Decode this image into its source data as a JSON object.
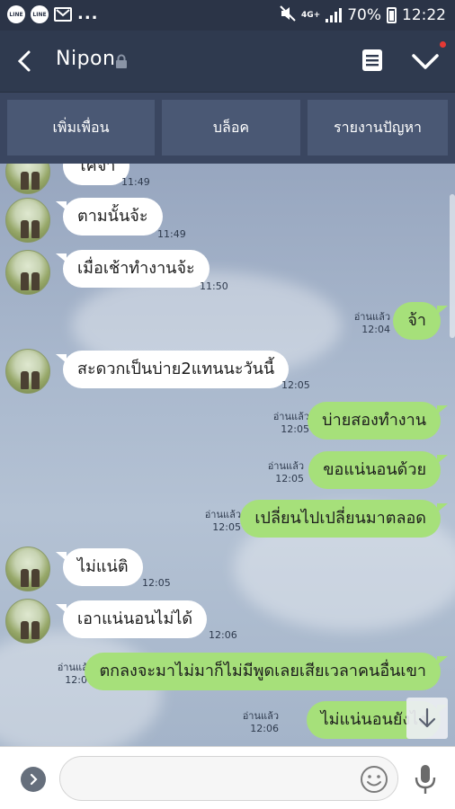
{
  "status_bar": {
    "left_icons": [
      "line-icon",
      "line-icon",
      "mail-icon"
    ],
    "left_badge_text": "LINE",
    "more": "...",
    "network": "4G+",
    "battery": "70%",
    "time": "12:22"
  },
  "header": {
    "contact_name": "Nipon",
    "icons": [
      "back-icon",
      "lock-icon",
      "note-icon",
      "chevron-down-icon"
    ]
  },
  "actions": [
    "เพิ่มเพื่อน",
    "บล็อค",
    "รายงานปัญหา"
  ],
  "messages": [
    {
      "side": "in",
      "text": "โคจ้า",
      "time": "11:49"
    },
    {
      "side": "in",
      "text": "ตามนั้นจ้ะ",
      "time": "11:49"
    },
    {
      "side": "in",
      "text": "เมื่อเช้าทำงานจ้ะ",
      "time": "11:50"
    },
    {
      "side": "out",
      "text": "จ้า",
      "read": "อ่านแล้ว",
      "time": "12:04"
    },
    {
      "side": "in",
      "text": "สะดวกเป็นบ่าย2แทนนะวันนี้",
      "time": "12:05"
    },
    {
      "side": "out",
      "text": "บ่ายสองทำงาน",
      "read": "อ่านแล้ว",
      "time": "12:05"
    },
    {
      "side": "out",
      "text": "ขอแน่นอนด้วย",
      "read": "อ่านแล้ว",
      "time": "12:05"
    },
    {
      "side": "out",
      "text": "เปลี่ยนไปเปลี่ยนมาตลอด",
      "read": "อ่านแล้ว",
      "time": "12:05"
    },
    {
      "side": "in",
      "text": "ไม่แน่ติ",
      "time": "12:05"
    },
    {
      "side": "in",
      "text": "เอาแน่นอนไม่ได้",
      "time": "12:06"
    },
    {
      "side": "out",
      "text": "ตกลงจะมาไม่มาก็ไม่มีพูดเลยเสียเวลาคนอื่นเขา",
      "read": "อ่านแล้ว",
      "time": "12:06"
    },
    {
      "side": "out",
      "text": "ไม่แน่นอนยังไง",
      "read": "อ่านแล้ว",
      "time": "12:06"
    }
  ],
  "input": {
    "value": "",
    "placeholder": ""
  },
  "colors": {
    "header_bg": "#2f3a4f",
    "action_button_bg": "#4a5874",
    "incoming_bubble": "#ffffff",
    "outgoing_bubble": "#a6e07a",
    "notification_dot": "#e53935"
  }
}
